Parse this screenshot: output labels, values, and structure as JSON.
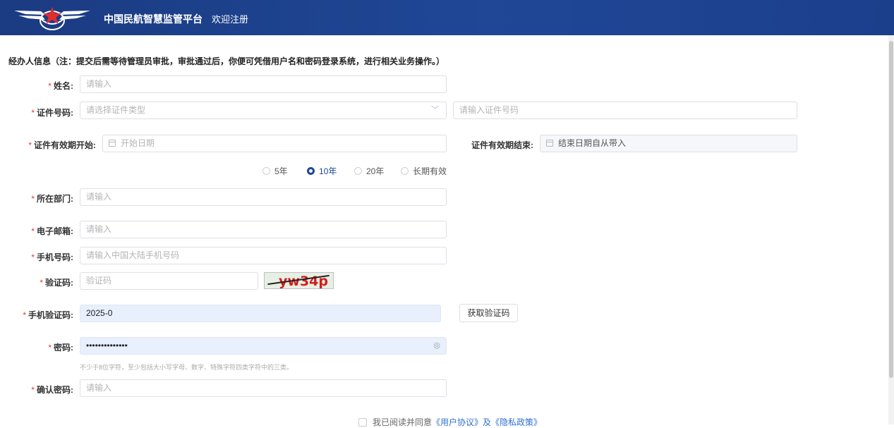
{
  "header": {
    "brand": "中国民航智慧监管平台",
    "subtitle": "欢迎注册",
    "logo_icon": "winged-star-logo-icon",
    "background_color": "#1f4796"
  },
  "notice": "经办人信息（注：提交后需等待管理员审批，审批通过后，你便可凭借用户名和密码登录系统，进行相关业务操作。）",
  "form": {
    "name": {
      "label": "姓名:",
      "placeholder": "请输入",
      "value": ""
    },
    "id_number": {
      "label": "证件号码:",
      "type_placeholder": "请选择证件类型",
      "number_placeholder": "请输入证件号码"
    },
    "validity_start": {
      "label": "证件有效期开始:",
      "placeholder": "开始日期"
    },
    "validity_end": {
      "label": "证件有效期结束:",
      "placeholder": "结束日期自从带入"
    },
    "validity_options": [
      {
        "label": "5年",
        "selected": false
      },
      {
        "label": "10年",
        "selected": true
      },
      {
        "label": "20年",
        "selected": false
      },
      {
        "label": "长期有效",
        "selected": false
      }
    ],
    "department": {
      "label": "所在部门:",
      "placeholder": "请输入"
    },
    "email": {
      "label": "电子邮箱:",
      "placeholder": "请输入"
    },
    "phone": {
      "label": "手机号码:",
      "placeholder": "请输入中国大陆手机号码"
    },
    "captcha": {
      "label": "验证码:",
      "placeholder": "验证码",
      "image_text": "yw34p"
    },
    "sms_code": {
      "label": "手机验证码:",
      "value": "2025-0",
      "button": "获取验证码"
    },
    "password": {
      "label": "密码:",
      "value": "••••••••••••••",
      "hint": "不少于8位字符，至少包括大小写字母、数字、特殊字符四类字符中的三类。"
    },
    "confirm_password": {
      "label": "确认密码:",
      "placeholder": "请输入"
    },
    "agreement": {
      "prefix": "我已阅读并同意",
      "link": "《用户协议》及《隐私政策》"
    },
    "required_mark": "*"
  },
  "colors": {
    "accent": "#1f4796",
    "required": "#e53935",
    "autofill_bg": "#e8f0fe"
  }
}
